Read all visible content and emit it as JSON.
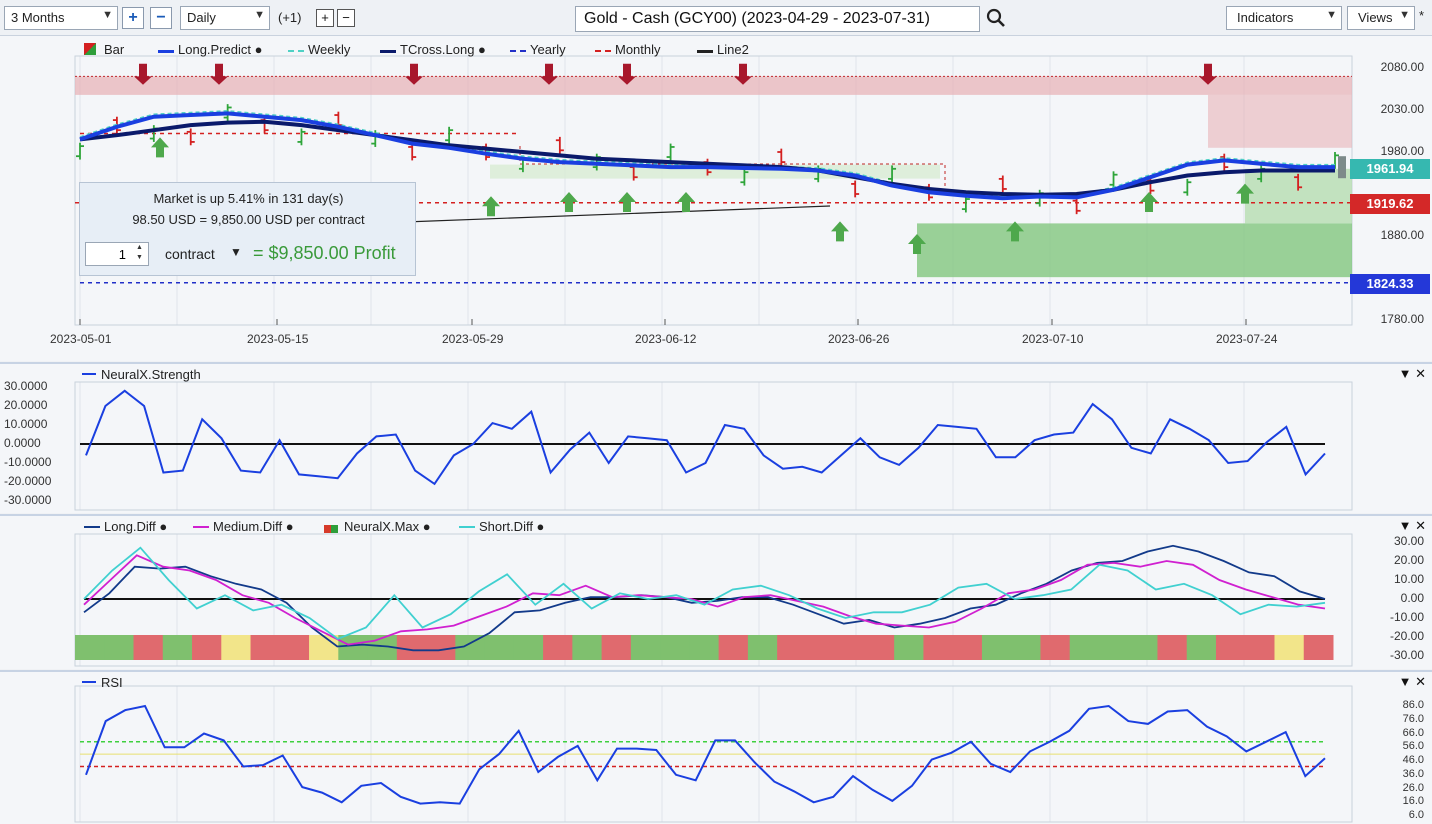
{
  "toolbar": {
    "period": "3 Months",
    "interval": "Daily",
    "offset": "(+1)",
    "title": "Gold - Cash (GCY00) (2023-04-29 - 2023-07-31)",
    "indicators": "Indicators",
    "views": "Views",
    "star": "*"
  },
  "price_pane": {
    "legend": [
      {
        "label": "Bar",
        "color": "#2e9e3a",
        "icon": "bar-icon"
      },
      {
        "label": "Long.Predict",
        "color": "#1a3fe0",
        "dot": true
      },
      {
        "label": "Weekly",
        "color": "#4fd1c5",
        "style": "dashed"
      },
      {
        "label": "TCross.Long",
        "color": "#0a1a6b",
        "dot": true
      },
      {
        "label": "Yearly",
        "color": "#2230c8",
        "style": "dashed"
      },
      {
        "label": "Monthly",
        "color": "#d42020",
        "style": "dashed"
      },
      {
        "label": "Line2",
        "color": "#222222"
      }
    ],
    "y_ticks": [
      "2080.00",
      "2030.00",
      "1980.00",
      "1880.00",
      "1780.00"
    ],
    "x_ticks": [
      "2023-05-01",
      "2023-05-15",
      "2023-05-29",
      "2023-06-12",
      "2023-06-26",
      "2023-07-10",
      "2023-07-24"
    ],
    "last_price": "1961.94",
    "monthly_level": "1919.62",
    "yearly_level": "1824.33",
    "market_box": {
      "line1": "Market is up 5.41% in 131 day(s)",
      "line2": "98.50 USD = 9,850.00 USD per contract",
      "quantity": "1",
      "unit": "contract",
      "profit": "= $9,850.00 Profit"
    }
  },
  "strength_pane": {
    "legend": "NeuralX.Strength",
    "y_ticks": [
      "30.0000",
      "20.0000",
      "10.0000",
      "0.0000",
      "-10.0000",
      "-20.0000",
      "-30.0000"
    ],
    "controls": "▼ ✕"
  },
  "diff_pane": {
    "legend": [
      {
        "label": "Long.Diff",
        "color": "#123a8a"
      },
      {
        "label": "Medium.Diff",
        "color": "#d020d0"
      },
      {
        "label": "NeuralX.Max",
        "color": "#d63a2a"
      },
      {
        "label": "Short.Diff",
        "color": "#40d0d0"
      }
    ],
    "y_ticks": [
      "30.00",
      "20.00",
      "10.00",
      "0.00",
      "-10.00",
      "-20.00",
      "-30.00"
    ],
    "controls": "▼ ✕"
  },
  "rsi_pane": {
    "legend": "RSI",
    "y_ticks": [
      "86.0",
      "76.0",
      "66.0",
      "56.0",
      "46.0",
      "36.0",
      "26.0",
      "16.0",
      "6.0"
    ],
    "controls": "▼ ✕"
  },
  "chart_data": [
    {
      "type": "line",
      "title": "Gold - Cash (GCY00) (2023-04-29 - 2023-07-31)",
      "ylim": [
        1760,
        2100
      ],
      "x_ticks": [
        "2023-05-01",
        "2023-05-15",
        "2023-05-29",
        "2023-06-12",
        "2023-06-26",
        "2023-07-10",
        "2023-07-24"
      ],
      "series": [
        {
          "name": "Long.Predict",
          "values": [
            1995,
            2010,
            2022,
            2024,
            2026,
            2022,
            2018,
            2010,
            2000,
            1990,
            1985,
            1978,
            1972,
            1968,
            1966,
            1964,
            1962,
            1962,
            1961,
            1960,
            1958,
            1952,
            1940,
            1932,
            1928,
            1925,
            1927,
            1926,
            1935,
            1950,
            1965,
            1970,
            1966,
            1962,
            1962
          ]
        },
        {
          "name": "TCross.Long",
          "values": [
            1995,
            2000,
            2006,
            2012,
            2015,
            2016,
            2012,
            2006,
            2000,
            1994,
            1988,
            1984,
            1980,
            1976,
            1972,
            1970,
            1968,
            1966,
            1964,
            1962,
            1958,
            1950,
            1942,
            1936,
            1932,
            1930,
            1929,
            1930,
            1935,
            1944,
            1952,
            1956,
            1958,
            1958,
            1958
          ]
        }
      ],
      "levels": {
        "last": 1961.94,
        "monthly": 1919.62,
        "yearly": 1824.33
      }
    },
    {
      "type": "line",
      "series": [
        {
          "name": "NeuralX.Strength",
          "values": [
            -6,
            20,
            28,
            20,
            -15,
            -14,
            13,
            3,
            -14,
            -15,
            2,
            -16,
            -17,
            -18,
            -5,
            4,
            5,
            -14,
            -21,
            -6,
            0,
            11,
            8,
            17,
            -15,
            -3,
            6,
            -10,
            4,
            3,
            2,
            -15,
            -10,
            10,
            8,
            -6,
            -13,
            -12,
            -15,
            -6,
            3,
            -7,
            -11,
            -2,
            10,
            9,
            8,
            -7,
            -7,
            2,
            5,
            6,
            21,
            13,
            -2,
            -5,
            13,
            8,
            2,
            -10,
            -9,
            1,
            9,
            -16,
            -5
          ]
        }
      ],
      "ylim": [
        -30,
        30
      ]
    },
    {
      "type": "line",
      "series": [
        {
          "name": "Long.Diff",
          "values": [
            -7,
            3,
            17,
            16,
            17,
            12,
            8,
            5,
            -2,
            -15,
            -25,
            -24,
            -25,
            -27,
            -27,
            -25,
            -18,
            -7,
            -6,
            -2,
            1,
            1,
            2,
            1,
            -2,
            -1,
            1,
            1,
            -3,
            -8,
            -13,
            -11,
            -15,
            -13,
            -10,
            -5,
            -3,
            3,
            8,
            15,
            19,
            20,
            25,
            28,
            25,
            20,
            14,
            12,
            4,
            0
          ]
        },
        {
          "name": "Medium.Diff",
          "values": [
            -3,
            10,
            23,
            17,
            15,
            10,
            2,
            -2,
            -10,
            -17,
            -24,
            -22,
            -17,
            -16,
            -14,
            -9,
            -4,
            3,
            2,
            7,
            1,
            2,
            1,
            0,
            -4,
            1,
            2,
            -1,
            -4,
            -9,
            -13,
            -14,
            -15,
            -12,
            -5,
            3,
            5,
            10,
            18,
            19,
            17,
            20,
            18,
            10,
            5,
            1,
            -3,
            -5
          ]
        },
        {
          "name": "Short.Diff",
          "values": [
            0,
            15,
            27,
            10,
            -5,
            2,
            -6,
            -3,
            -10,
            -21,
            -15,
            2,
            -15,
            -8,
            4,
            13,
            -3,
            8,
            -5,
            3,
            0,
            2,
            -3,
            5,
            7,
            2,
            -5,
            -10,
            -7,
            -7,
            -3,
            6,
            8,
            0,
            2,
            5,
            18,
            15,
            5,
            8,
            2,
            -8,
            -3,
            -4,
            -2
          ]
        }
      ],
      "bands": [
        "green",
        "green",
        "red",
        "green",
        "red",
        "yellow",
        "red",
        "red",
        "yellow",
        "green",
        "green",
        "red",
        "red",
        "green",
        "green",
        "green",
        "red",
        "green",
        "red",
        "green",
        "green",
        "green",
        "red",
        "green",
        "red",
        "red",
        "red",
        "red",
        "green",
        "red",
        "red",
        "green",
        "green",
        "red",
        "green",
        "green",
        "green",
        "red",
        "green",
        "red",
        "red",
        "yellow",
        "red"
      ],
      "ylim": [
        -30,
        30
      ]
    },
    {
      "type": "line",
      "series": [
        {
          "name": "RSI",
          "values": [
            36,
            75,
            83,
            86,
            56,
            56,
            66,
            61,
            42,
            43,
            50,
            27,
            23,
            16,
            28,
            30,
            20,
            15,
            16,
            15,
            40,
            51,
            68,
            38,
            49,
            57,
            32,
            55,
            55,
            54,
            36,
            32,
            61,
            61,
            45,
            31,
            24,
            16,
            20,
            35,
            25,
            17,
            28,
            47,
            52,
            60,
            44,
            38,
            53,
            60,
            68,
            84,
            86,
            75,
            73,
            82,
            83,
            71,
            64,
            53,
            60,
            67,
            35,
            48
          ]
        }
      ],
      "ylim": [
        6,
        86
      ],
      "levels": {
        "upper": 60,
        "lower": 42
      }
    }
  ]
}
